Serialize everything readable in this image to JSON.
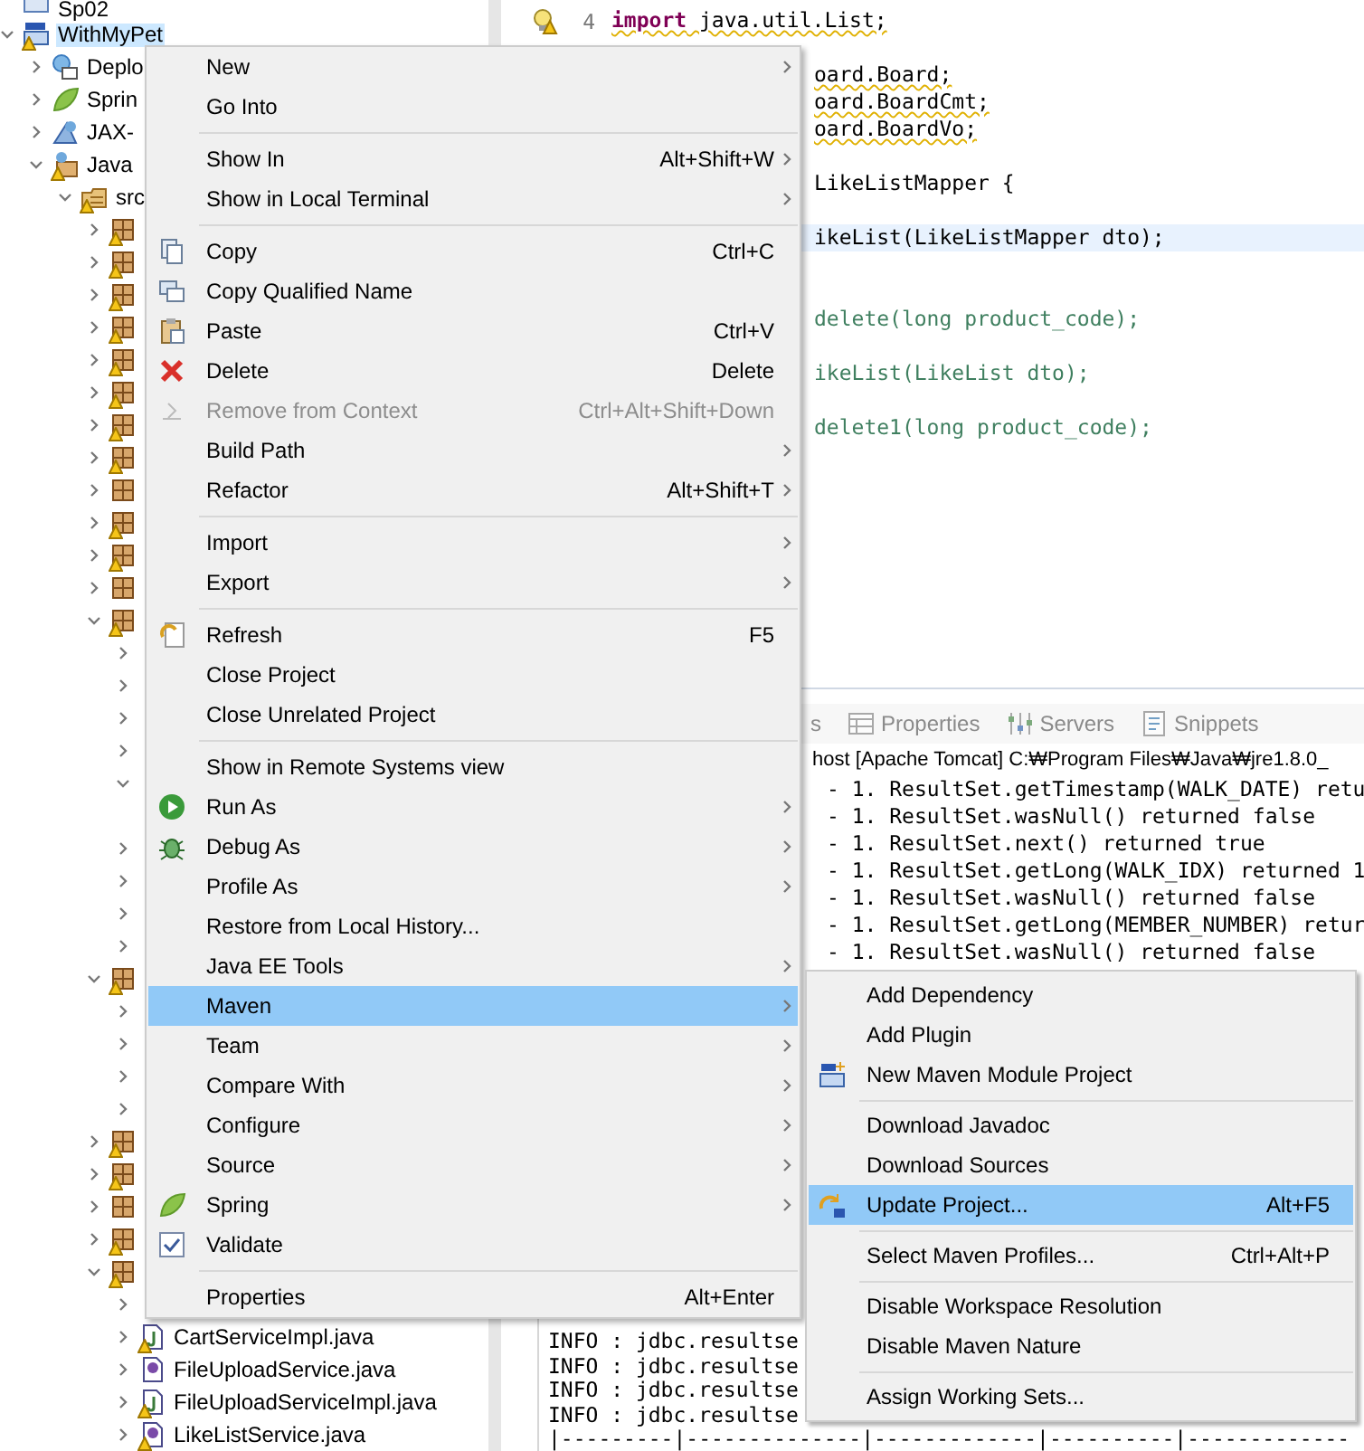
{
  "tree": [
    {
      "label": "Sp02",
      "kind": "project",
      "selected": false
    },
    {
      "label": "WithMyPet",
      "kind": "maven-project",
      "warning": true,
      "expanded": true,
      "selected": true,
      "children": [
        {
          "label": "Deplo",
          "kind": "deploy",
          "expanded": false,
          "selected": false
        },
        {
          "label": "Sprin",
          "kind": "spring",
          "expanded": false,
          "selected": false
        },
        {
          "label": "JAX-",
          "kind": "jax",
          "expanded": false,
          "selected": false
        },
        {
          "label": "Java",
          "kind": "library",
          "warning": true,
          "expanded": true,
          "selected": false,
          "children": [
            {
              "label": "src",
              "kind": "source-folder",
              "warning": true,
              "expanded": true,
              "selected": false,
              "children": [
                {
                  "kind": "package",
                  "warning": true,
                  "expanded": false,
                  "selected": false
                },
                {
                  "kind": "package",
                  "warning": true,
                  "expanded": false,
                  "selected": false
                },
                {
                  "kind": "package",
                  "warning": true,
                  "expanded": false,
                  "selected": false
                },
                {
                  "kind": "package",
                  "warning": true,
                  "expanded": false,
                  "selected": false
                },
                {
                  "kind": "package",
                  "warning": true,
                  "expanded": false,
                  "selected": false
                },
                {
                  "kind": "package",
                  "warning": true,
                  "expanded": false,
                  "selected": false
                },
                {
                  "kind": "package",
                  "warning": true,
                  "expanded": false,
                  "selected": false
                },
                {
                  "kind": "package",
                  "warning": true,
                  "expanded": false,
                  "selected": false
                },
                {
                  "kind": "package",
                  "warning": false,
                  "expanded": false,
                  "selected": false
                },
                {
                  "kind": "package",
                  "warning": true,
                  "expanded": false,
                  "selected": false
                },
                {
                  "kind": "package",
                  "warning": true,
                  "expanded": false,
                  "selected": false
                },
                {
                  "kind": "package",
                  "warning": false,
                  "expanded": false,
                  "selected": false
                },
                {
                  "kind": "package",
                  "warning": true,
                  "expanded": true,
                  "selected": false,
                  "children": [
                    {
                      "expanded": false,
                      "selected": false
                    },
                    {
                      "expanded": false,
                      "selected": false
                    },
                    {
                      "expanded": false,
                      "selected": false
                    },
                    {
                      "expanded": false,
                      "selected": false
                    },
                    {
                      "expanded": true,
                      "selected": false,
                      "children": [
                        {
                          "selected": false
                        }
                      ]
                    },
                    {
                      "expanded": false,
                      "selected": false
                    },
                    {
                      "expanded": false,
                      "selected": false
                    },
                    {
                      "expanded": false,
                      "selected": false
                    },
                    {
                      "expanded": false,
                      "selected": false
                    }
                  ]
                },
                {
                  "kind": "package",
                  "warning": true,
                  "expanded": true,
                  "selected": false,
                  "children": [
                    {
                      "expanded": false,
                      "selected": false
                    },
                    {
                      "expanded": false,
                      "selected": false
                    },
                    {
                      "expanded": false,
                      "selected": false
                    },
                    {
                      "expanded": false,
                      "selected": false
                    }
                  ]
                },
                {
                  "kind": "package",
                  "warning": true,
                  "expanded": false,
                  "selected": false
                },
                {
                  "kind": "package",
                  "warning": true,
                  "expanded": false,
                  "selected": false
                },
                {
                  "kind": "package",
                  "warning": false,
                  "expanded": false,
                  "selected": false
                },
                {
                  "kind": "package",
                  "warning": true,
                  "expanded": false,
                  "selected": false
                },
                {
                  "kind": "package",
                  "warning": true,
                  "expanded": true,
                  "selected": false,
                  "children": [
                    {
                      "expanded": false,
                      "selected": false
                    },
                    {
                      "label": "CartServiceImpl.java",
                      "kind": "class",
                      "warning": true,
                      "expanded": false,
                      "selected": false
                    },
                    {
                      "label": "FileUploadService.java",
                      "kind": "interface",
                      "warning": false,
                      "expanded": false,
                      "selected": false
                    },
                    {
                      "label": "FileUploadServiceImpl.java",
                      "kind": "class",
                      "warning": true,
                      "expanded": false,
                      "selected": false
                    },
                    {
                      "label": "LikeListService.java",
                      "kind": "interface",
                      "warning": true,
                      "expanded": false,
                      "selected": false
                    }
                  ]
                }
              ]
            }
          ]
        }
      ]
    }
  ],
  "editor": {
    "lines": [
      {
        "kind": "full",
        "number": "4",
        "text": "**import** java.util.List;",
        "warning": true,
        "current": false
      },
      {
        "kind": "blank"
      },
      {
        "kind": "tail",
        "text": "oard.Board;",
        "warning": true,
        "current": false
      },
      {
        "kind": "tail",
        "text": "oard.BoardCmt;",
        "warning": true,
        "current": false
      },
      {
        "kind": "tail",
        "text": "oard.BoardVo;",
        "warning": true,
        "current": false
      },
      {
        "kind": "blank"
      },
      {
        "kind": "tail",
        "text": "LikeListMapper {",
        "warning": false,
        "current": false
      },
      {
        "kind": "blank"
      },
      {
        "kind": "tail",
        "text": "ikeList(LikeListMapper dto);",
        "warning": false,
        "current": true
      },
      {
        "kind": "blank"
      },
      {
        "kind": "blank"
      },
      {
        "kind": "comment",
        "text": "delete(long product_code);",
        "warning": false,
        "current": false
      },
      {
        "kind": "blank"
      },
      {
        "kind": "comment",
        "text": "ikeList(LikeList dto);",
        "warning": false,
        "current": false
      },
      {
        "kind": "blank"
      },
      {
        "kind": "comment",
        "text": "delete1(long product_code);",
        "warning": false,
        "current": false
      }
    ]
  },
  "console": {
    "tabs": [
      {
        "label": "s",
        "kind": "plain",
        "selected": false
      },
      {
        "label": "Properties",
        "kind": "properties",
        "selected": false
      },
      {
        "label": "Servers",
        "kind": "servers",
        "selected": false
      },
      {
        "label": "Snippets",
        "kind": "snippets",
        "selected": false
      }
    ],
    "header": "host [Apache Tomcat] C:₩Program Files₩Java₩jre1.8.0_",
    "top_lines": [
      "- 1. ResultSet.getTimestamp(WALK_DATE) retu",
      "- 1. ResultSet.wasNull() returned false",
      "- 1. ResultSet.next() returned true",
      "- 1. ResultSet.getLong(WALK_IDX) returned 1",
      "- 1. ResultSet.wasNull() returned false",
      "- 1. ResultSet.getLong(MEMBER_NUMBER) retur",
      "- 1. ResultSet.wasNull() returned false"
    ],
    "bottom_lines": [
      "INFO : jdbc.resultse",
      "INFO : jdbc.resultse",
      "INFO : jdbc.resultse",
      "INFO : jdbc.resultse",
      "|---------|--------------|-------------|----------|-------------"
    ]
  },
  "context_menu": {
    "items": [
      {
        "kind": "text",
        "label": "New",
        "submenu": true,
        "disabled": false,
        "selected": false
      },
      {
        "kind": "text",
        "label": "Go Into",
        "submenu": false,
        "disabled": false,
        "selected": false
      },
      {
        "kind": "separator"
      },
      {
        "kind": "text",
        "label": "Show In",
        "shortcut": "Alt+Shift+W",
        "submenu": true,
        "disabled": false,
        "selected": false
      },
      {
        "kind": "text",
        "label": "Show in Local Terminal",
        "submenu": true,
        "disabled": false,
        "selected": false
      },
      {
        "kind": "separator"
      },
      {
        "kind": "copy",
        "label": "Copy",
        "shortcut": "Ctrl+C",
        "submenu": false,
        "disabled": false,
        "selected": false
      },
      {
        "kind": "copy-name",
        "label": "Copy Qualified Name",
        "submenu": false,
        "disabled": false,
        "selected": false
      },
      {
        "kind": "paste",
        "label": "Paste",
        "shortcut": "Ctrl+V",
        "submenu": false,
        "disabled": false,
        "selected": false
      },
      {
        "kind": "delete",
        "label": "Delete",
        "shortcut": "Delete",
        "submenu": false,
        "disabled": false,
        "selected": false
      },
      {
        "kind": "context",
        "label": "Remove from Context",
        "shortcut": "Ctrl+Alt+Shift+Down",
        "submenu": false,
        "disabled": true,
        "selected": false
      },
      {
        "kind": "text",
        "label": "Build Path",
        "submenu": true,
        "disabled": false,
        "selected": false
      },
      {
        "kind": "text",
        "label": "Refactor",
        "shortcut": "Alt+Shift+T",
        "submenu": true,
        "disabled": false,
        "selected": false
      },
      {
        "kind": "separator"
      },
      {
        "kind": "text",
        "label": "Import",
        "submenu": true,
        "disabled": false,
        "selected": false
      },
      {
        "kind": "text",
        "label": "Export",
        "submenu": true,
        "disabled": false,
        "selected": false
      },
      {
        "kind": "separator"
      },
      {
        "kind": "refresh",
        "label": "Refresh",
        "shortcut": "F5",
        "submenu": false,
        "disabled": false,
        "selected": false
      },
      {
        "kind": "text",
        "label": "Close Project",
        "submenu": false,
        "disabled": false,
        "selected": false
      },
      {
        "kind": "text",
        "label": "Close Unrelated Project",
        "submenu": false,
        "disabled": false,
        "selected": false
      },
      {
        "kind": "separator"
      },
      {
        "kind": "text",
        "label": "Show in Remote Systems view",
        "submenu": false,
        "disabled": false,
        "selected": false
      },
      {
        "kind": "run",
        "label": "Run As",
        "submenu": true,
        "disabled": false,
        "selected": false
      },
      {
        "kind": "debug",
        "label": "Debug As",
        "submenu": true,
        "disabled": false,
        "selected": false
      },
      {
        "kind": "text",
        "label": "Profile As",
        "submenu": true,
        "disabled": false,
        "selected": false
      },
      {
        "kind": "text",
        "label": "Restore from Local History...",
        "submenu": false,
        "disabled": false,
        "selected": false
      },
      {
        "kind": "text",
        "label": "Java EE Tools",
        "submenu": true,
        "disabled": false,
        "selected": false
      },
      {
        "kind": "text",
        "label": "Maven",
        "submenu": true,
        "disabled": false,
        "selected": true
      },
      {
        "kind": "text",
        "label": "Team",
        "submenu": true,
        "disabled": false,
        "selected": false
      },
      {
        "kind": "text",
        "label": "Compare With",
        "submenu": true,
        "disabled": false,
        "selected": false
      },
      {
        "kind": "text",
        "label": "Configure",
        "submenu": true,
        "disabled": false,
        "selected": false
      },
      {
        "kind": "text",
        "label": "Source",
        "submenu": true,
        "disabled": false,
        "selected": false
      },
      {
        "kind": "spring",
        "label": "Spring",
        "submenu": true,
        "disabled": false,
        "selected": false
      },
      {
        "kind": "validate",
        "label": "Validate",
        "submenu": false,
        "disabled": false,
        "selected": false
      },
      {
        "kind": "separator"
      },
      {
        "kind": "text",
        "label": "Properties",
        "shortcut": "Alt+Enter",
        "submenu": false,
        "disabled": false,
        "selected": false
      }
    ]
  },
  "submenu": {
    "items": [
      {
        "kind": "text",
        "label": "Add Dependency",
        "disabled": false,
        "selected": false
      },
      {
        "kind": "text",
        "label": "Add Plugin",
        "disabled": false,
        "selected": false
      },
      {
        "kind": "maven-module",
        "label": "New Maven Module Project",
        "disabled": false,
        "selected": false
      },
      {
        "kind": "separator"
      },
      {
        "kind": "text",
        "label": "Download Javadoc",
        "disabled": false,
        "selected": false
      },
      {
        "kind": "text",
        "label": "Download Sources",
        "disabled": false,
        "selected": false
      },
      {
        "kind": "update",
        "label": "Update Project...",
        "shortcut": "Alt+F5",
        "disabled": false,
        "selected": true
      },
      {
        "kind": "separator"
      },
      {
        "kind": "text",
        "label": "Select Maven Profiles...",
        "shortcut": "Ctrl+Alt+P",
        "disabled": false,
        "selected": false
      },
      {
        "kind": "separator"
      },
      {
        "kind": "text",
        "label": "Disable Workspace Resolution",
        "disabled": false,
        "selected": false
      },
      {
        "kind": "text",
        "label": "Disable Maven Nature",
        "disabled": false,
        "selected": false
      },
      {
        "kind": "separator"
      },
      {
        "kind": "text",
        "label": "Assign Working Sets...",
        "disabled": false,
        "selected": false
      }
    ]
  }
}
